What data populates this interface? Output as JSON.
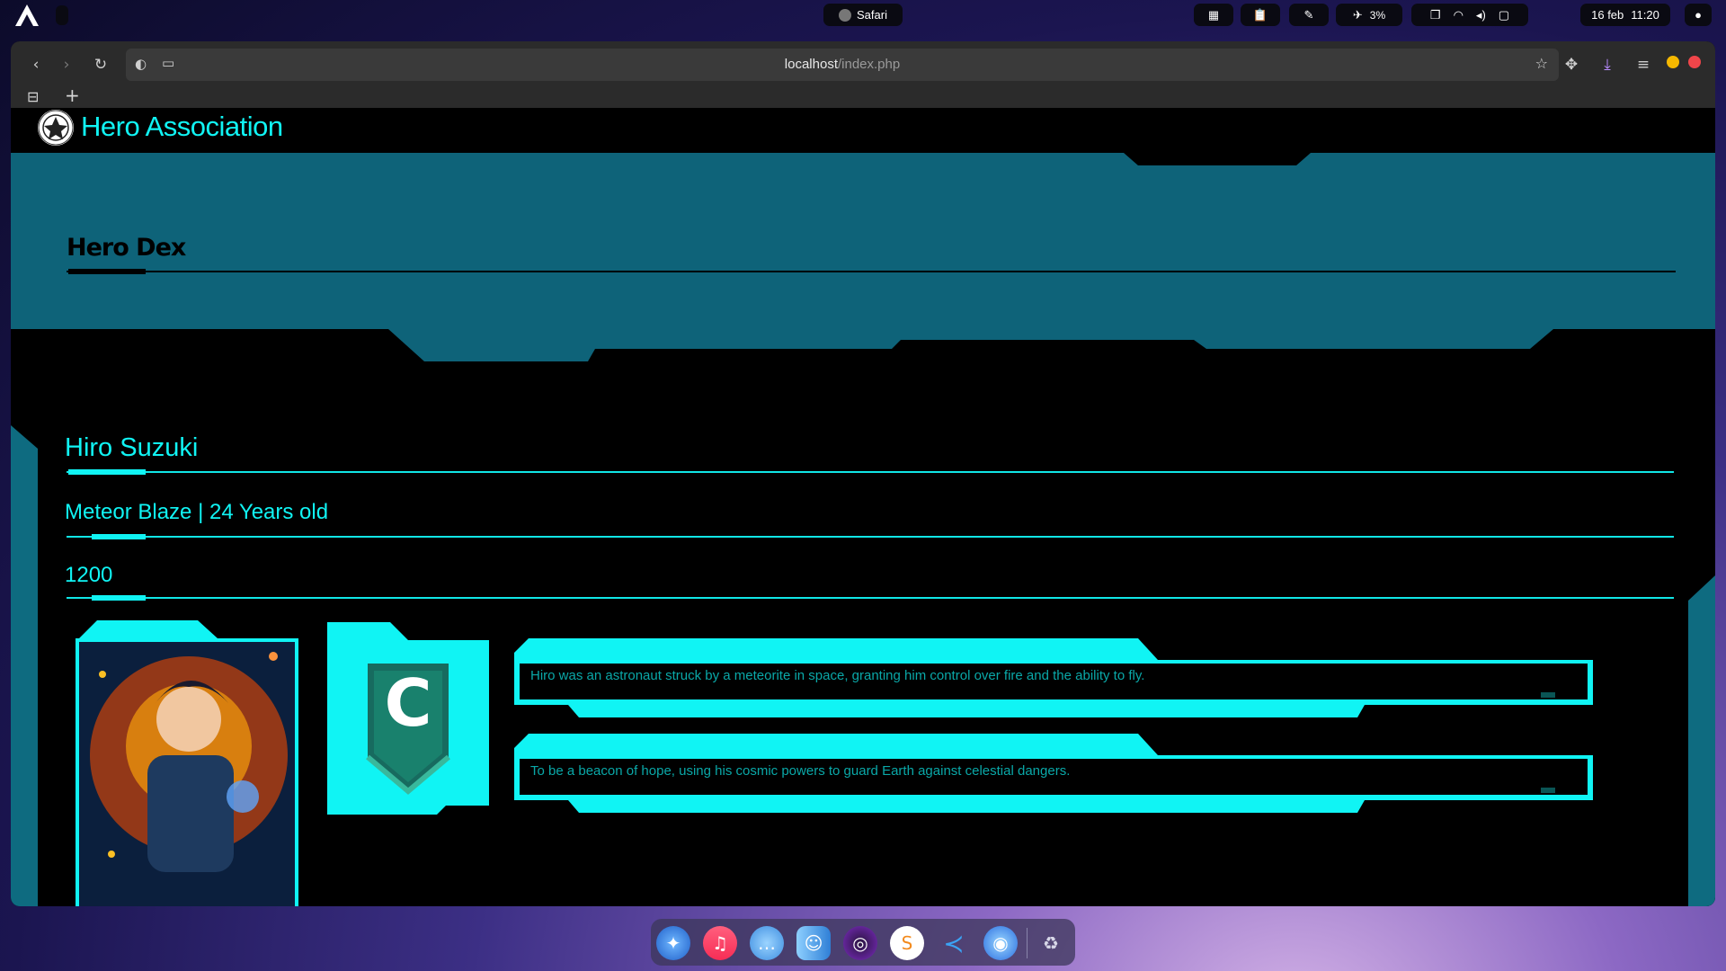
{
  "topbar": {
    "app_name": "Safari",
    "battery_percent": "3%",
    "date": "16 feb",
    "time": "11:20"
  },
  "browser": {
    "url_host": "localhost",
    "url_path": "/index.php"
  },
  "site": {
    "title": "Hero Association",
    "section_title": "Hero Dex"
  },
  "hero": {
    "name": "Hiro Suzuki",
    "alias_age": "Meteor Blaze | 24 Years old",
    "score": "1200",
    "rank_letter": "C",
    "origin": "Hiro was an astronaut struck by a meteorite in space, granting him control over fire and the ability to fly.",
    "mission": "To be a beacon of hope, using his cosmic powers to guard Earth against celestial dangers."
  },
  "colors": {
    "accent": "#10f4f4",
    "banner": "#0e6379",
    "panel": "#0e6b80"
  },
  "dock": {
    "icons": [
      "safari-icon",
      "music-icon",
      "messages-icon",
      "finder-icon",
      "orb-icon",
      "sublime-icon",
      "vscode-icon",
      "firefox-icon",
      "trash-icon"
    ]
  }
}
